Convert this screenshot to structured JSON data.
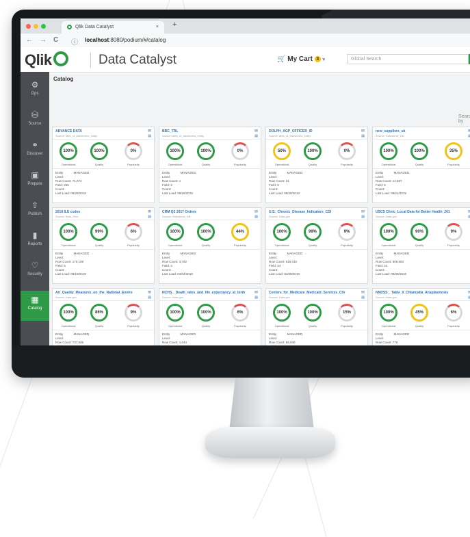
{
  "browser": {
    "tab_title": "Qlik Data Catalyst",
    "tab_close": "×",
    "new_tab": "+",
    "url_host": "localhost",
    "url_path": ":8080/podium/#/catalog",
    "nav": {
      "back": "←",
      "forward": "→",
      "reload": "C",
      "info": "ⓘ"
    }
  },
  "header": {
    "logo": "Qlik",
    "app_name": "Data Catalyst",
    "cart_label": "My Cart",
    "cart_count": "3",
    "cart_caret": "▾",
    "search_placeholder": "Global Search",
    "search_button": "Q"
  },
  "sidebar": {
    "items": [
      {
        "label": "Ops",
        "icon": "⚙"
      },
      {
        "label": "Source",
        "icon": "⛁"
      },
      {
        "label": "Discover",
        "icon": "⚭"
      },
      {
        "label": "Prepare",
        "icon": "▣"
      },
      {
        "label": "Publish",
        "icon": "⇧"
      },
      {
        "label": "Reports",
        "icon": "▮"
      },
      {
        "label": "Security",
        "icon": "♡"
      },
      {
        "label": "Catalog",
        "icon": "▦"
      }
    ],
    "active": "Catalog"
  },
  "main": {
    "breadcrumb": "Catalog",
    "search_by": "Search by",
    "gauge_labels": [
      "Operational",
      "Quality",
      "Popularity"
    ],
    "meta_labels": {
      "entity": "Entity",
      "level": "Level:",
      "rowcount": "Row Count:",
      "field": "Field:",
      "count": "Count:",
      "lastload": "Last Load:"
    },
    "cards": [
      {
        "title": "ADVANCE DATA",
        "source": "Source: dbfs_r3_transforms_entity",
        "g": [
          "100%",
          "100%",
          "0%"
        ],
        "rc": "71,074",
        "fld": "265",
        "ll": "09/25/2019"
      },
      {
        "title": "BBC_TRL",
        "source": "Source: dbfs_r3_transforms_entity",
        "g": [
          "100%",
          "100%",
          "0%"
        ],
        "rc": "1",
        "fld": "3",
        "ll": "09/25/2019"
      },
      {
        "title": "DOLPH_AGP_OFFICER_ID",
        "source": "Source: dbfs_r3_transforms_entity",
        "g": [
          "50%",
          "100%",
          "0%"
        ],
        "rc": "21",
        "fld": "5",
        "ll": "09/25/2019"
      },
      {
        "title": "new_suppliers_uk",
        "source": "Source: Salesforce_DB",
        "g": [
          "100%",
          "100%",
          "35%"
        ],
        "rc": "14,687",
        "fld": "5",
        "ll": "09/21/2019"
      },
      {
        "title": "2018 ILE codes",
        "source": "Source: Beta_Hive",
        "g": [
          "100%",
          "99%",
          "6%"
        ],
        "rc": "170,108",
        "fld": "5",
        "ll": "09/19/2019"
      },
      {
        "title": "CRM Q2 2017 Orders",
        "source": "Source: Salesforce_DB",
        "g": [
          "100%",
          "100%",
          "44%"
        ],
        "rc": "3,762",
        "fld": "3",
        "ll": "04/04/2019"
      },
      {
        "title": "U.S._Chronic_Disease_Indicators_CDI",
        "source": "Source: Data.gov",
        "g": [
          "100%",
          "99%",
          "9%"
        ],
        "rc": "519,015",
        "fld": "34",
        "ll": "04/29/2019"
      },
      {
        "title": "USCS Clinic_Local Data for Better Health_201",
        "source": "Source: Data.gov",
        "g": [
          "100%",
          "90%",
          "9%"
        ],
        "rc": "809,654",
        "fld": "24",
        "ll": "09/29/2019"
      },
      {
        "title": "Air_Quality_Measures_on_the_National_Enviro",
        "source": "Source: Data.gov",
        "g": [
          "100%",
          "86%",
          "9%"
        ],
        "rc": "737,835",
        "fld": "",
        "ll": ""
      },
      {
        "title": "NCHS__Death_rates_and_life_expectancy_at_birth",
        "source": "Source: Data.gov",
        "g": [
          "100%",
          "100%",
          "6%"
        ],
        "rc": "1,044",
        "fld": "",
        "ll": ""
      },
      {
        "title": "Centers_for_Medicare_Medicaid_Services_Chr",
        "source": "Source: Data.gov",
        "g": [
          "100%",
          "100%",
          "15%"
        ],
        "rc": "65,049",
        "fld": "",
        "ll": ""
      },
      {
        "title": "NNDSS__Table_II_Chlamydia_Anaplasmosis",
        "source": "Source: Data.gov",
        "g": [
          "100%",
          "45%",
          "6%"
        ],
        "rc": "776",
        "fld": "",
        "ll": ""
      }
    ],
    "managed": "MANAGED"
  },
  "colors": {
    "accent": "#2e9a48",
    "sidebar": "#4a4e52",
    "warn": "#f2c215",
    "link": "#2f6fb0"
  }
}
